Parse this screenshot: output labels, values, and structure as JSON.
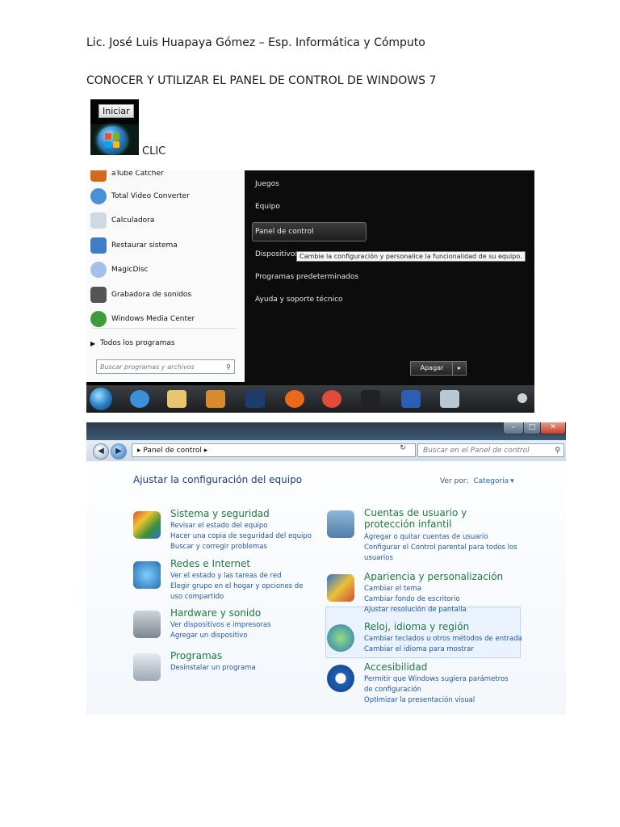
{
  "header": {
    "author_line": "Lic. José Luis Huapaya Gómez – Esp. Informática y Cómputo",
    "title": "CONOCER Y UTILIZAR EL PANEL DE CONTROL DE WINDOWS 7"
  },
  "start_button": {
    "label": "Iniciar",
    "clic": "CLIC"
  },
  "start_menu": {
    "left_items": [
      "aTube Catcher",
      "Total Video Converter",
      "Calculadora",
      "Restaurar sistema",
      "MagicDisc",
      "Grabadora de sonidos",
      "Windows Media Center"
    ],
    "all_programs": "Todos los programas",
    "search_placeholder": "Buscar programas y archivos",
    "right_items": [
      "Juegos",
      "Equipo",
      "Panel de control",
      "Dispositivos",
      "Programas predeterminados",
      "Ayuda y soporte técnico"
    ],
    "tooltip": "Cambie la configuración y personalice la funcionalidad de su equipo.",
    "shutdown_label": "Apagar"
  },
  "control_panel": {
    "address": "Panel de control",
    "search_placeholder": "Buscar en el Panel de control",
    "heading": "Ajustar la configuración del equipo",
    "view_by_label": "Ver por:",
    "view_by_value": "Categoría",
    "categories": [
      {
        "title": "Sistema y seguridad",
        "links": [
          "Revisar el estado del equipo",
          "Hacer una copia de seguridad del equipo",
          "Buscar y corregir problemas"
        ]
      },
      {
        "title": "Redes e Internet",
        "links": [
          "Ver el estado y las tareas de red",
          "Elegir grupo en el hogar y opciones de uso compartido"
        ]
      },
      {
        "title": "Hardware y sonido",
        "links": [
          "Ver dispositivos e impresoras",
          "Agregar un dispositivo"
        ]
      },
      {
        "title": "Programas",
        "links": [
          "Desinstalar un programa"
        ]
      },
      {
        "title": "Cuentas de usuario y protección infantil",
        "links": [
          "Agregar o quitar cuentas de usuario",
          "Configurar el Control parental para todos los usuarios"
        ]
      },
      {
        "title": "Apariencia y personalización",
        "links": [
          "Cambiar el tema",
          "Cambiar fondo de escritorio",
          "Ajustar resolución de pantalla"
        ]
      },
      {
        "title": "Reloj, idioma y región",
        "links": [
          "Cambiar teclados u otros métodos de entrada",
          "Cambiar el idioma para mostrar"
        ]
      },
      {
        "title": "Accesibilidad",
        "links": [
          "Permitir que Windows sugiera parámetros de configuración",
          "Optimizar la presentación visual"
        ]
      }
    ]
  }
}
